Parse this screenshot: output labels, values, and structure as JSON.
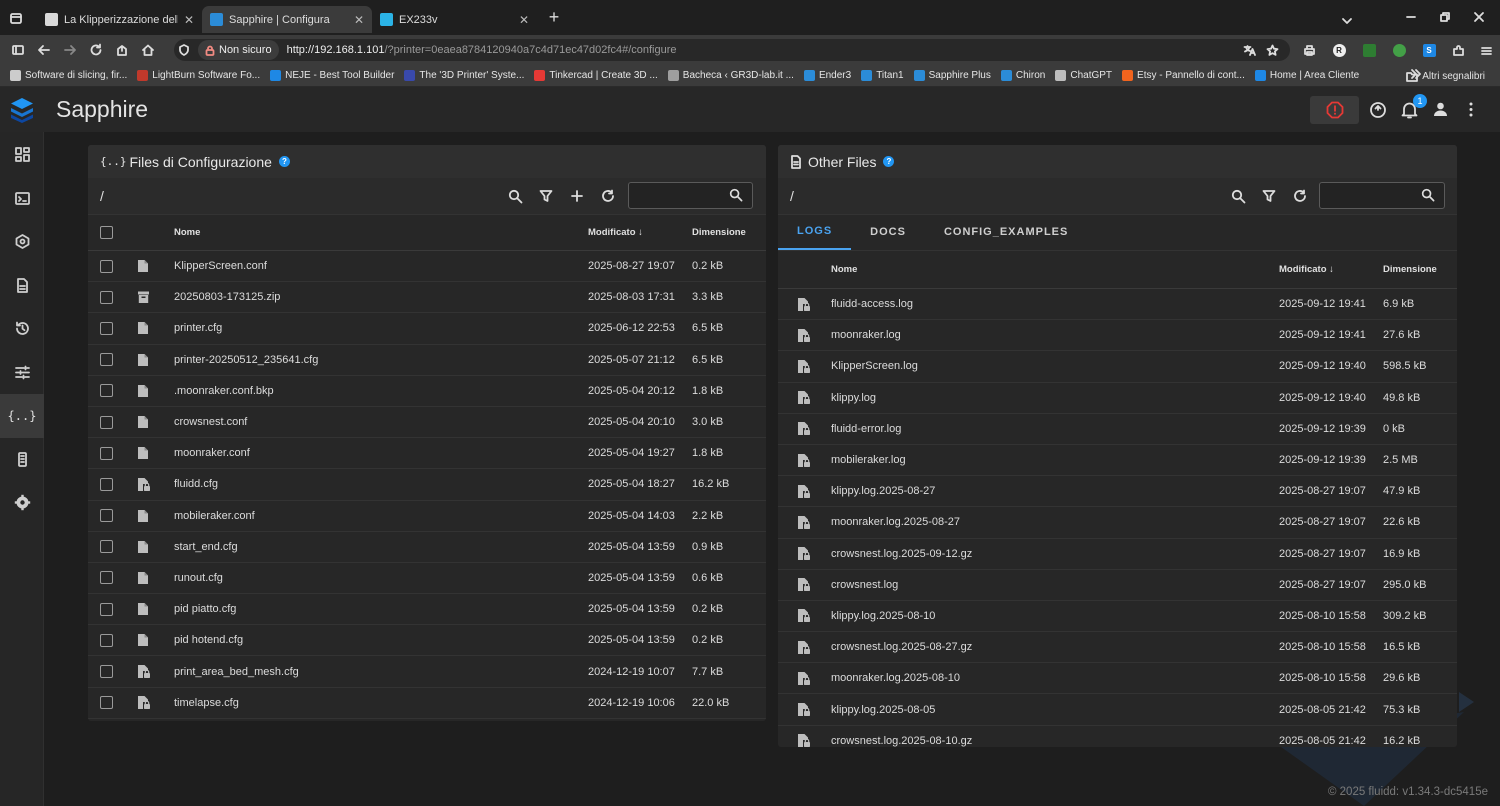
{
  "browser": {
    "tabs": [
      {
        "title": "La Klipperizzazione della Chiron",
        "active": false,
        "fav_color": "#d9d9d9"
      },
      {
        "title": "Sapphire | Configura",
        "active": true,
        "fav_color": "#2b8cd8"
      },
      {
        "title": "EX233v",
        "active": false,
        "fav_color": "#2bb3e6"
      }
    ],
    "new_tab_label": "+",
    "security_label": "Non sicuro",
    "url_host": "http://192.168.1.101",
    "url_rest": "/?printer=0eaea8784120940a7c4d71ec47d02fc4#/configure",
    "bookmarks": [
      {
        "label": "Software di slicing, fir...",
        "color": "#cccccc"
      },
      {
        "label": "LightBurn Software Fo...",
        "color": "#c0392b"
      },
      {
        "label": "NEJE - Best Tool Builder",
        "color": "#1e88e5"
      },
      {
        "label": "The '3D Printer' Syste...",
        "color": "#3949ab"
      },
      {
        "label": "Tinkercad | Create 3D ...",
        "color": "#e53935"
      },
      {
        "label": "Bacheca ‹ GR3D-lab.it ...",
        "color": "#9e9e9e"
      },
      {
        "label": "Ender3",
        "color": "#2b8cd8"
      },
      {
        "label": "Titan1",
        "color": "#2b8cd8"
      },
      {
        "label": "Sapphire Plus",
        "color": "#2b8cd8"
      },
      {
        "label": "Chiron",
        "color": "#2b8cd8"
      },
      {
        "label": "ChatGPT",
        "color": "#bdbdbd"
      },
      {
        "label": "Etsy - Pannello di cont...",
        "color": "#f1641e"
      },
      {
        "label": "Home | Area Cliente",
        "color": "#1e88e5"
      }
    ],
    "other_bookmarks": "Altri segnalibri"
  },
  "app": {
    "title": "Sapphire",
    "notification_count": "1",
    "footer": "© 2025 fluidd: v1.34.3-dc5415e"
  },
  "config_card": {
    "title": "Files di Configurazione",
    "path": "/",
    "columns": {
      "name": "Nome",
      "modified": "Modificato",
      "size": "Dimensione"
    },
    "rows": [
      {
        "icon": "file",
        "name": "KlipperScreen.conf",
        "modified": "2025-08-27 19:07",
        "size": "0.2 kB"
      },
      {
        "icon": "archive",
        "name": "20250803-173125.zip",
        "modified": "2025-08-03 17:31",
        "size": "3.3 kB"
      },
      {
        "icon": "file",
        "name": "printer.cfg",
        "modified": "2025-06-12 22:53",
        "size": "6.5 kB"
      },
      {
        "icon": "file",
        "name": "printer-20250512_235641.cfg",
        "modified": "2025-05-07 21:12",
        "size": "6.5 kB"
      },
      {
        "icon": "file",
        "name": ".moonraker.conf.bkp",
        "modified": "2025-05-04 20:12",
        "size": "1.8 kB"
      },
      {
        "icon": "file",
        "name": "crowsnest.conf",
        "modified": "2025-05-04 20:10",
        "size": "3.0 kB"
      },
      {
        "icon": "file",
        "name": "moonraker.conf",
        "modified": "2025-05-04 19:27",
        "size": "1.8 kB"
      },
      {
        "icon": "lock",
        "name": "fluidd.cfg",
        "modified": "2025-05-04 18:27",
        "size": "16.2 kB"
      },
      {
        "icon": "file",
        "name": "mobileraker.conf",
        "modified": "2025-05-04 14:03",
        "size": "2.2 kB"
      },
      {
        "icon": "file",
        "name": "start_end.cfg",
        "modified": "2025-05-04 13:59",
        "size": "0.9 kB"
      },
      {
        "icon": "file",
        "name": "runout.cfg",
        "modified": "2025-05-04 13:59",
        "size": "0.6 kB"
      },
      {
        "icon": "file",
        "name": "pid piatto.cfg",
        "modified": "2025-05-04 13:59",
        "size": "0.2 kB"
      },
      {
        "icon": "file",
        "name": "pid hotend.cfg",
        "modified": "2025-05-04 13:59",
        "size": "0.2 kB"
      },
      {
        "icon": "lock",
        "name": "print_area_bed_mesh.cfg",
        "modified": "2024-12-19 10:07",
        "size": "7.7 kB"
      },
      {
        "icon": "lock",
        "name": "timelapse.cfg",
        "modified": "2024-12-19 10:06",
        "size": "22.0 kB"
      }
    ]
  },
  "other_card": {
    "title": "Other Files",
    "path": "/",
    "tabs": [
      "LOGS",
      "DOCS",
      "CONFIG_EXAMPLES"
    ],
    "columns": {
      "name": "Nome",
      "modified": "Modificato",
      "size": "Dimensione"
    },
    "rows": [
      {
        "name": "fluidd-access.log",
        "modified": "2025-09-12 19:41",
        "size": "6.9 kB"
      },
      {
        "name": "moonraker.log",
        "modified": "2025-09-12 19:41",
        "size": "27.6 kB"
      },
      {
        "name": "KlipperScreen.log",
        "modified": "2025-09-12 19:40",
        "size": "598.5 kB"
      },
      {
        "name": "klippy.log",
        "modified": "2025-09-12 19:40",
        "size": "49.8 kB"
      },
      {
        "name": "fluidd-error.log",
        "modified": "2025-09-12 19:39",
        "size": "0 kB"
      },
      {
        "name": "mobileraker.log",
        "modified": "2025-09-12 19:39",
        "size": "2.5 MB"
      },
      {
        "name": "klippy.log.2025-08-27",
        "modified": "2025-08-27 19:07",
        "size": "47.9 kB"
      },
      {
        "name": "moonraker.log.2025-08-27",
        "modified": "2025-08-27 19:07",
        "size": "22.6 kB"
      },
      {
        "name": "crowsnest.log.2025-09-12.gz",
        "modified": "2025-08-27 19:07",
        "size": "16.9 kB"
      },
      {
        "name": "crowsnest.log",
        "modified": "2025-08-27 19:07",
        "size": "295.0 kB"
      },
      {
        "name": "klippy.log.2025-08-10",
        "modified": "2025-08-10 15:58",
        "size": "309.2 kB"
      },
      {
        "name": "crowsnest.log.2025-08-27.gz",
        "modified": "2025-08-10 15:58",
        "size": "16.5 kB"
      },
      {
        "name": "moonraker.log.2025-08-10",
        "modified": "2025-08-10 15:58",
        "size": "29.6 kB"
      },
      {
        "name": "klippy.log.2025-08-05",
        "modified": "2025-08-05 21:42",
        "size": "75.3 kB"
      },
      {
        "name": "crowsnest.log.2025-08-10.gz",
        "modified": "2025-08-05 21:42",
        "size": "16.2 kB"
      }
    ]
  },
  "sidebar_icons": [
    "dashboard-icon",
    "console-icon",
    "printer-icon",
    "jobs-icon",
    "history-icon",
    "tune-icon",
    "configure-icon",
    "system-icon",
    "settings-icon"
  ]
}
